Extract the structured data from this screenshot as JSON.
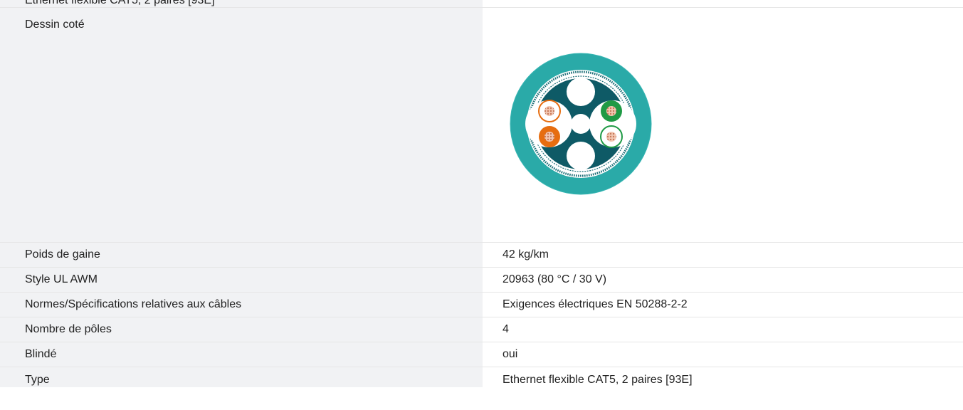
{
  "header": {
    "cut_text": "Ethernet flexible CAT5, 2 paires [93E]"
  },
  "rows": [
    {
      "label": "Dessin coté",
      "value": ""
    },
    {
      "label": "Poids de gaine",
      "value": "42 kg/km"
    },
    {
      "label": "Style UL AWM",
      "value": "20963 (80 °C / 30 V)"
    },
    {
      "label": "Normes/Spécifications relatives aux câbles",
      "value": "Exigences électriques EN 50288-2-2"
    },
    {
      "label": "Nombre de pôles",
      "value": "4"
    },
    {
      "label": "Blindé",
      "value": "oui"
    },
    {
      "label": "Type",
      "value": "Ethernet flexible CAT5, 2 paires [93E]"
    }
  ],
  "colors": {
    "label_bg": "#f1f2f4",
    "sheath": "#2aaaa8",
    "inner": "#0e5a66",
    "orange": "#e66d10",
    "green": "#1f9a45",
    "copper": "#c87a5a"
  }
}
